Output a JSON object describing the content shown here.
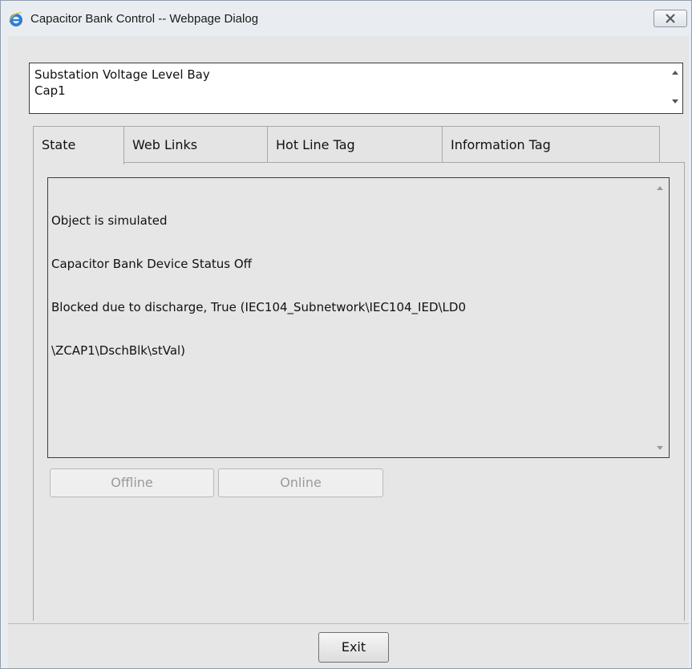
{
  "window": {
    "title": "Capacitor Bank Control -- Webpage Dialog",
    "app_icon": "internet-explorer-icon",
    "close_icon": "close-icon"
  },
  "object_path": {
    "line1": "Substation Voltage Level Bay",
    "line2": "Cap1"
  },
  "tabs": [
    {
      "label": "State",
      "active": true
    },
    {
      "label": "Web Links",
      "active": false
    },
    {
      "label": "Hot Line Tag",
      "active": false
    },
    {
      "label": "Information Tag",
      "active": false
    }
  ],
  "state": {
    "lines": [
      "Object is simulated",
      "Capacitor Bank Device Status Off",
      "Blocked due to discharge, True (IEC104_Subnetwork\\IEC104_IED\\LD0",
      "\\ZCAP1\\DschBlk\\stVal)"
    ]
  },
  "buttons": {
    "offline": "Offline",
    "online": "Online",
    "exit": "Exit"
  },
  "colors": {
    "background": "#e6e6e6",
    "disabled_text": "#9a9a9a",
    "ie_blue": "#2a7fd4",
    "ie_ring": "#f2b01e"
  }
}
